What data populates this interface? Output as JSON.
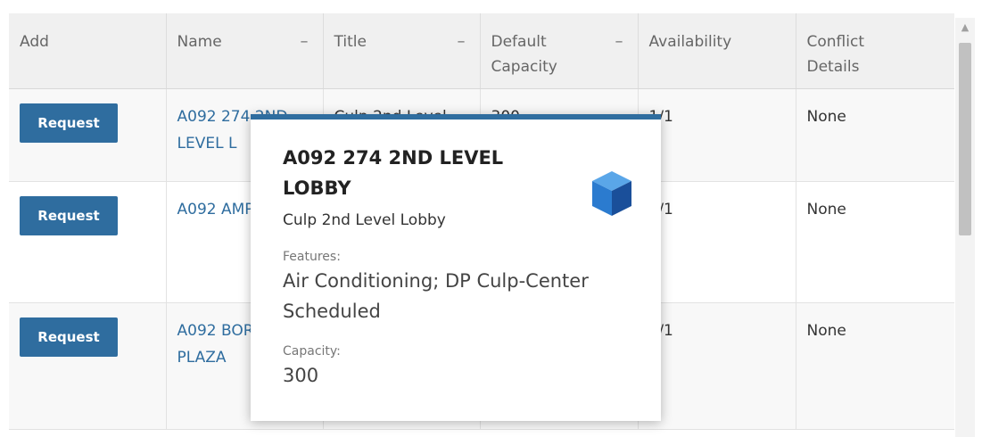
{
  "table": {
    "headers": {
      "add": "Add",
      "name": "Name",
      "title": "Title",
      "capacity": "Default Capacity",
      "availability": "Availability",
      "conflict": "Conflict Details"
    },
    "sort_indicator": "–",
    "rows": [
      {
        "button": "Request",
        "name": "A092 274 2ND LEVEL L",
        "title": "Culp 2nd Level",
        "capacity": "300",
        "availability": "1/1",
        "conflict": "None"
      },
      {
        "button": "Request",
        "name": "A092 AMPHIT R",
        "title": "",
        "capacity": "",
        "availability": "1/1",
        "conflict": "None"
      },
      {
        "button": "Request",
        "name": "A092 BORCHU PLAZA",
        "title": "",
        "capacity": "",
        "availability": "1/1",
        "conflict": "None"
      }
    ]
  },
  "popup": {
    "title": "A092 274 2ND LEVEL LOBBY",
    "subtitle": "Culp 2nd Level Lobby",
    "features_label": "Features:",
    "features_value": "Air Conditioning; DP Culp-Center Scheduled",
    "capacity_label": "Capacity:",
    "capacity_value": "300",
    "icon": "cube-icon"
  },
  "colors": {
    "accent": "#2f6d9f",
    "header_bg": "#f0f0f0",
    "cube_light": "#5aa6e8",
    "cube_mid": "#2b7bcf",
    "cube_dark": "#1a4f9a"
  }
}
